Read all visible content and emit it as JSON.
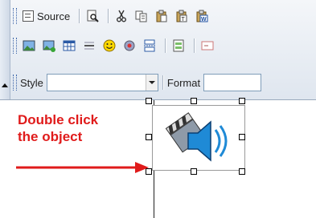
{
  "toolbar": {
    "source_label": "Source",
    "style_label": "Style",
    "style_value": "",
    "format_label": "Format",
    "format_value": "",
    "row1_icons": [
      "preview-icon",
      "cut-icon",
      "copy-icon",
      "paste-icon",
      "paste-text-icon",
      "paste-word-icon"
    ],
    "row2_icons": [
      "image-icon",
      "insert-image-icon",
      "table-icon",
      "horizontal-rule-icon",
      "smiley-icon",
      "special-char-icon",
      "page-break-icon",
      "form-icon",
      "textfield-icon"
    ]
  },
  "editor": {
    "object_icon": "media-object-icon",
    "annotation_line1": "Double click",
    "annotation_line2": "the object",
    "annotation_color": "#e01b1b"
  }
}
